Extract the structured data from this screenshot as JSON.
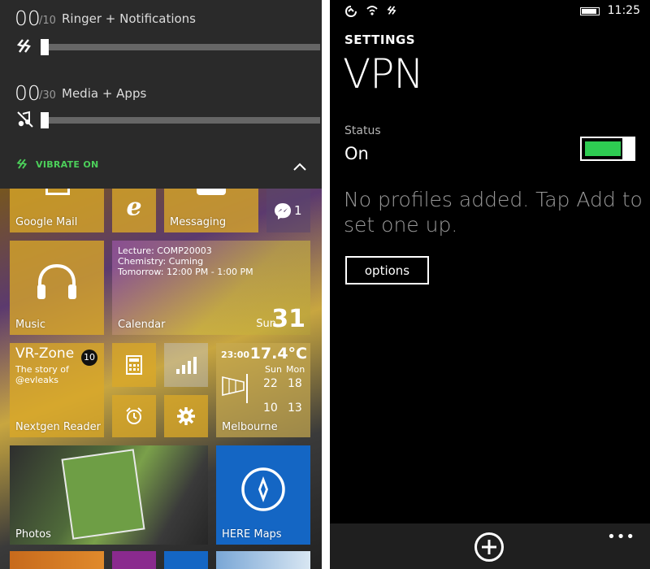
{
  "volume": {
    "ringer": {
      "value": "00",
      "max": "/10",
      "label": "Ringer + Notifications",
      "level": 0
    },
    "media": {
      "value": "00",
      "max": "/30",
      "label": "Media + Apps",
      "level": 0
    },
    "vibrate_label": "VIBRATE ON",
    "accent_color": "#4ccf5a"
  },
  "tiles": {
    "google_mail": "Google Mail",
    "messaging": "Messaging",
    "messenger_count": "1",
    "music": "Music",
    "calendar": {
      "label": "Calendar",
      "event1": "Lecture: COMP20003",
      "event2": "Chemistry: Cuming",
      "event3": "Tomorrow: 12:00 PM - 1:00 PM",
      "day": "Sun",
      "date": "31"
    },
    "nextgen": {
      "title": "VR-Zone",
      "badge": "10",
      "line1": "The story of",
      "line2": "@evleaks",
      "label": "Nextgen Reader"
    },
    "weather": {
      "time": "23:00",
      "temp": "17.4°C",
      "day1": "Sun",
      "day2": "Mon",
      "hi1": "22",
      "hi2": "18",
      "lo1": "10",
      "lo2": "13",
      "label": "Melbourne"
    },
    "photos": "Photos",
    "here_maps": "HERE Maps"
  },
  "vpn": {
    "clock": "11:25",
    "settings": "SETTINGS",
    "title": "VPN",
    "status_caption": "Status",
    "status_value": "On",
    "empty_message": "No profiles added. Tap Add to set one up.",
    "options_label": "options",
    "more": "•••",
    "toggle_color": "#2ecc52"
  }
}
